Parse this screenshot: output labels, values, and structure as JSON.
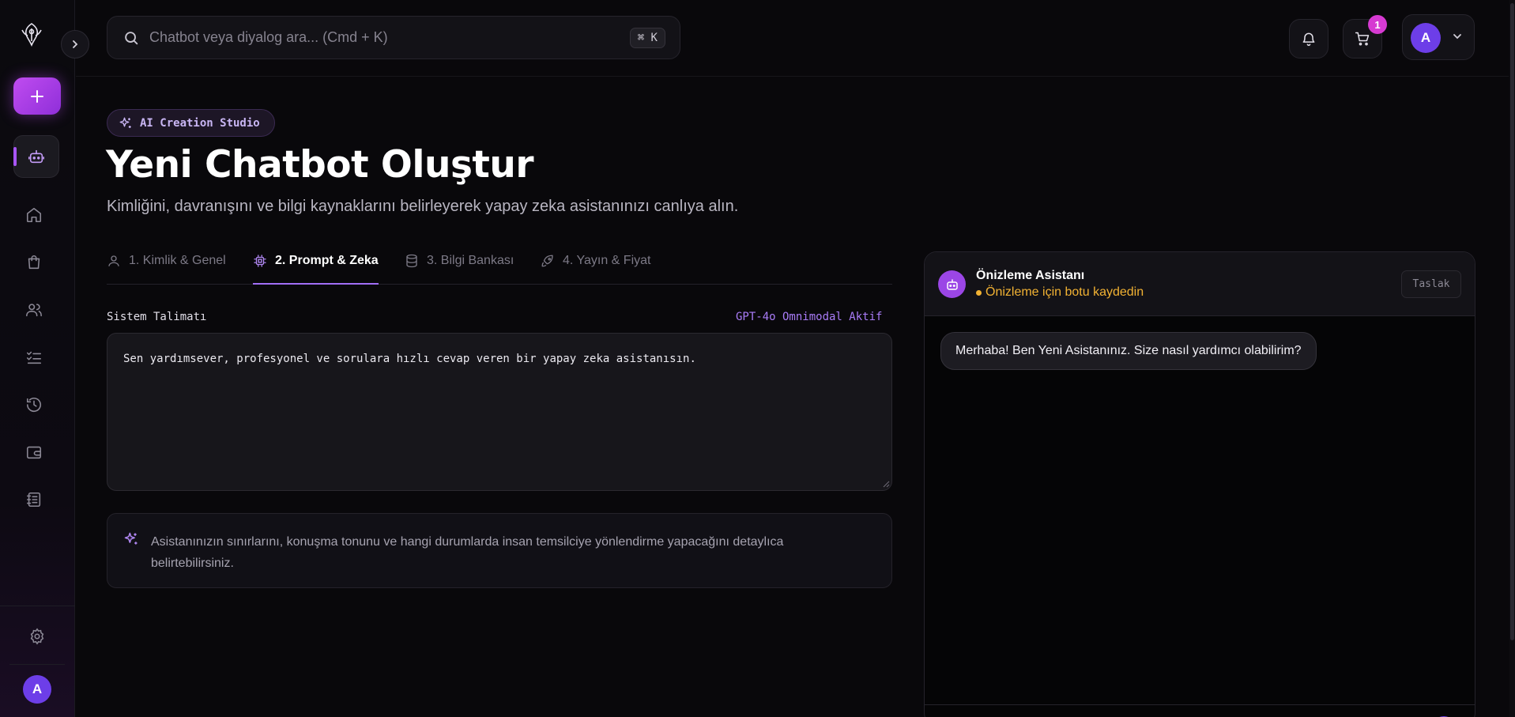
{
  "search": {
    "placeholder": "Chatbot veya diyalog ara... (Cmd + K)",
    "shortcut": "⌘ K"
  },
  "header": {
    "cart_count": "1",
    "user_initial": "A"
  },
  "sidebar": {
    "user_initial": "A",
    "items": [
      "home-icon",
      "shopping-bag-icon",
      "users-icon",
      "checklist-icon",
      "history-icon",
      "wallet-icon",
      "notebook-icon"
    ]
  },
  "page": {
    "badge": "AI Creation Studio",
    "title": "Yeni Chatbot Oluştur",
    "subtitle": "Kimliğini, davranışını ve bilgi kaynaklarını belirleyerek yapay zeka asistanınızı canlıya alın."
  },
  "tabs": [
    {
      "label": "1. Kimlik & Genel",
      "icon": "user-icon",
      "active": false
    },
    {
      "label": "2. Prompt & Zeka",
      "icon": "cpu-icon",
      "active": true
    },
    {
      "label": "3. Bilgi Bankası",
      "icon": "database-icon",
      "active": false
    },
    {
      "label": "4. Yayın & Fiyat",
      "icon": "rocket-icon",
      "active": false
    }
  ],
  "form": {
    "system_label": "Sistem Talimatı",
    "model_label": "GPT-4o Omnimodal Aktif",
    "system_prompt": "Sen yardımsever, profesyonel ve sorulara hızlı cevap veren bir yapay zeka asistanısın.",
    "hint": "Asistanınızın sınırlarını, konuşma tonunu ve hangi durumlarda insan temsilciye yönlendirme yapacağını detaylıca belirtebilirsiniz."
  },
  "preview": {
    "title": "Önizleme Asistanı",
    "status": "Önizleme için botu kaydedin",
    "chip": "Taslak",
    "greeting": "Merhaba! Ben Yeni Asistanınız. Size nasıl yardımcı olabilirim?"
  },
  "colors": {
    "accent": "#a855f7",
    "status_warning": "#f2b233",
    "badge": "#d63ad2"
  }
}
